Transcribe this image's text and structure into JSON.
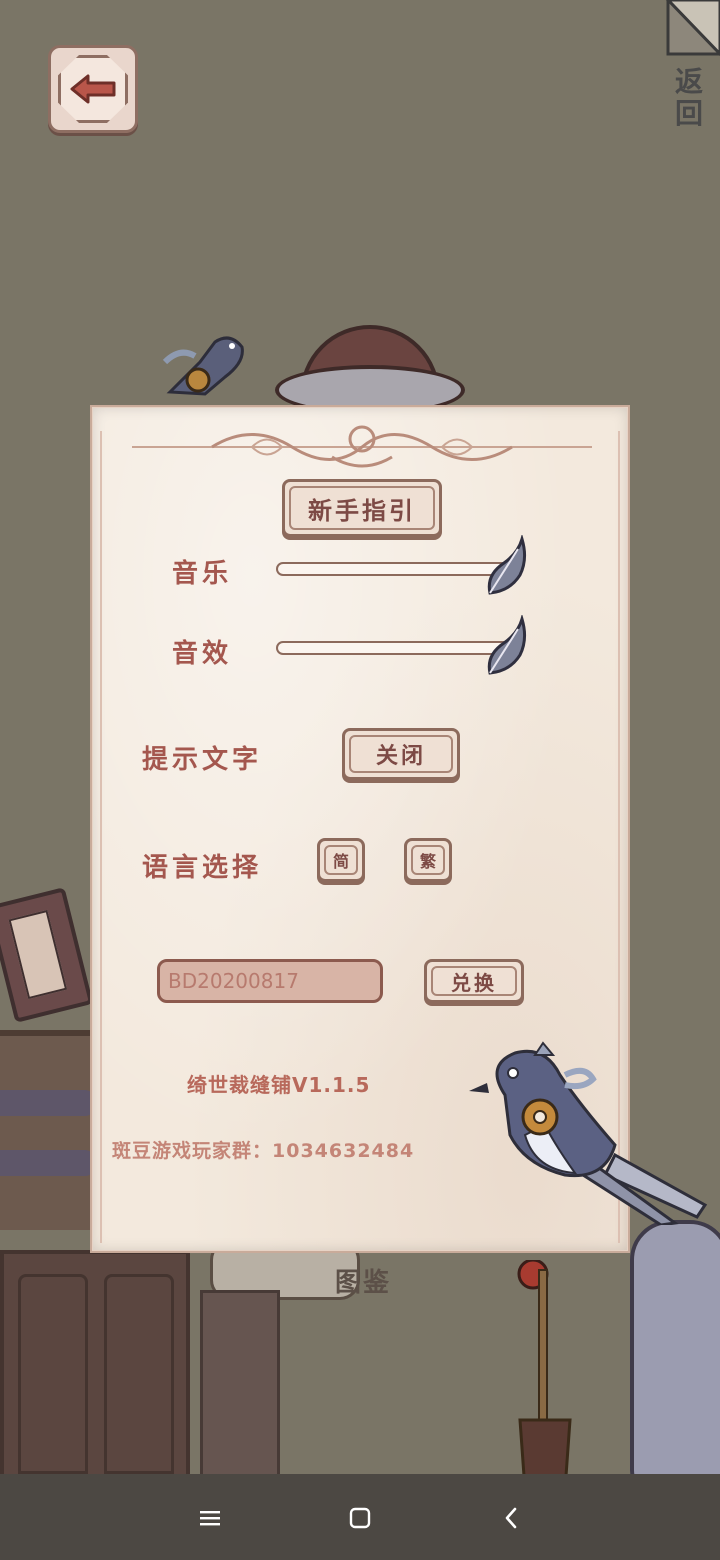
{
  "window": {
    "back_hint": "返回",
    "scene_label": "图鉴"
  },
  "settings": {
    "guide_button": "新手指引",
    "music_label": "音乐",
    "music_level": 1.0,
    "sfx_label": "音效",
    "sfx_level": 1.0,
    "hint_label": "提示文字",
    "hint_toggle": "关闭",
    "language_label": "语言选择",
    "language_simplified": "简",
    "language_traditional": "繁",
    "redeem_code_value": "BD20200817",
    "redeem_button": "兑换",
    "version_text": "绮世裁缝铺V1.1.5",
    "group_text": "斑豆游戏玩家群：1034632484"
  },
  "colors": {
    "background": "#7a7566",
    "panel": "#f3e9dd",
    "label_text": "#a4574e",
    "button_border": "#8c6a5c"
  },
  "icons": {
    "back": "arrow-left-icon",
    "corner": "corner-flag-icon",
    "slider_knob": "feather-icon",
    "nav_menu": "menu-icon",
    "nav_home": "home-square-icon",
    "nav_back": "chevron-left-icon"
  }
}
